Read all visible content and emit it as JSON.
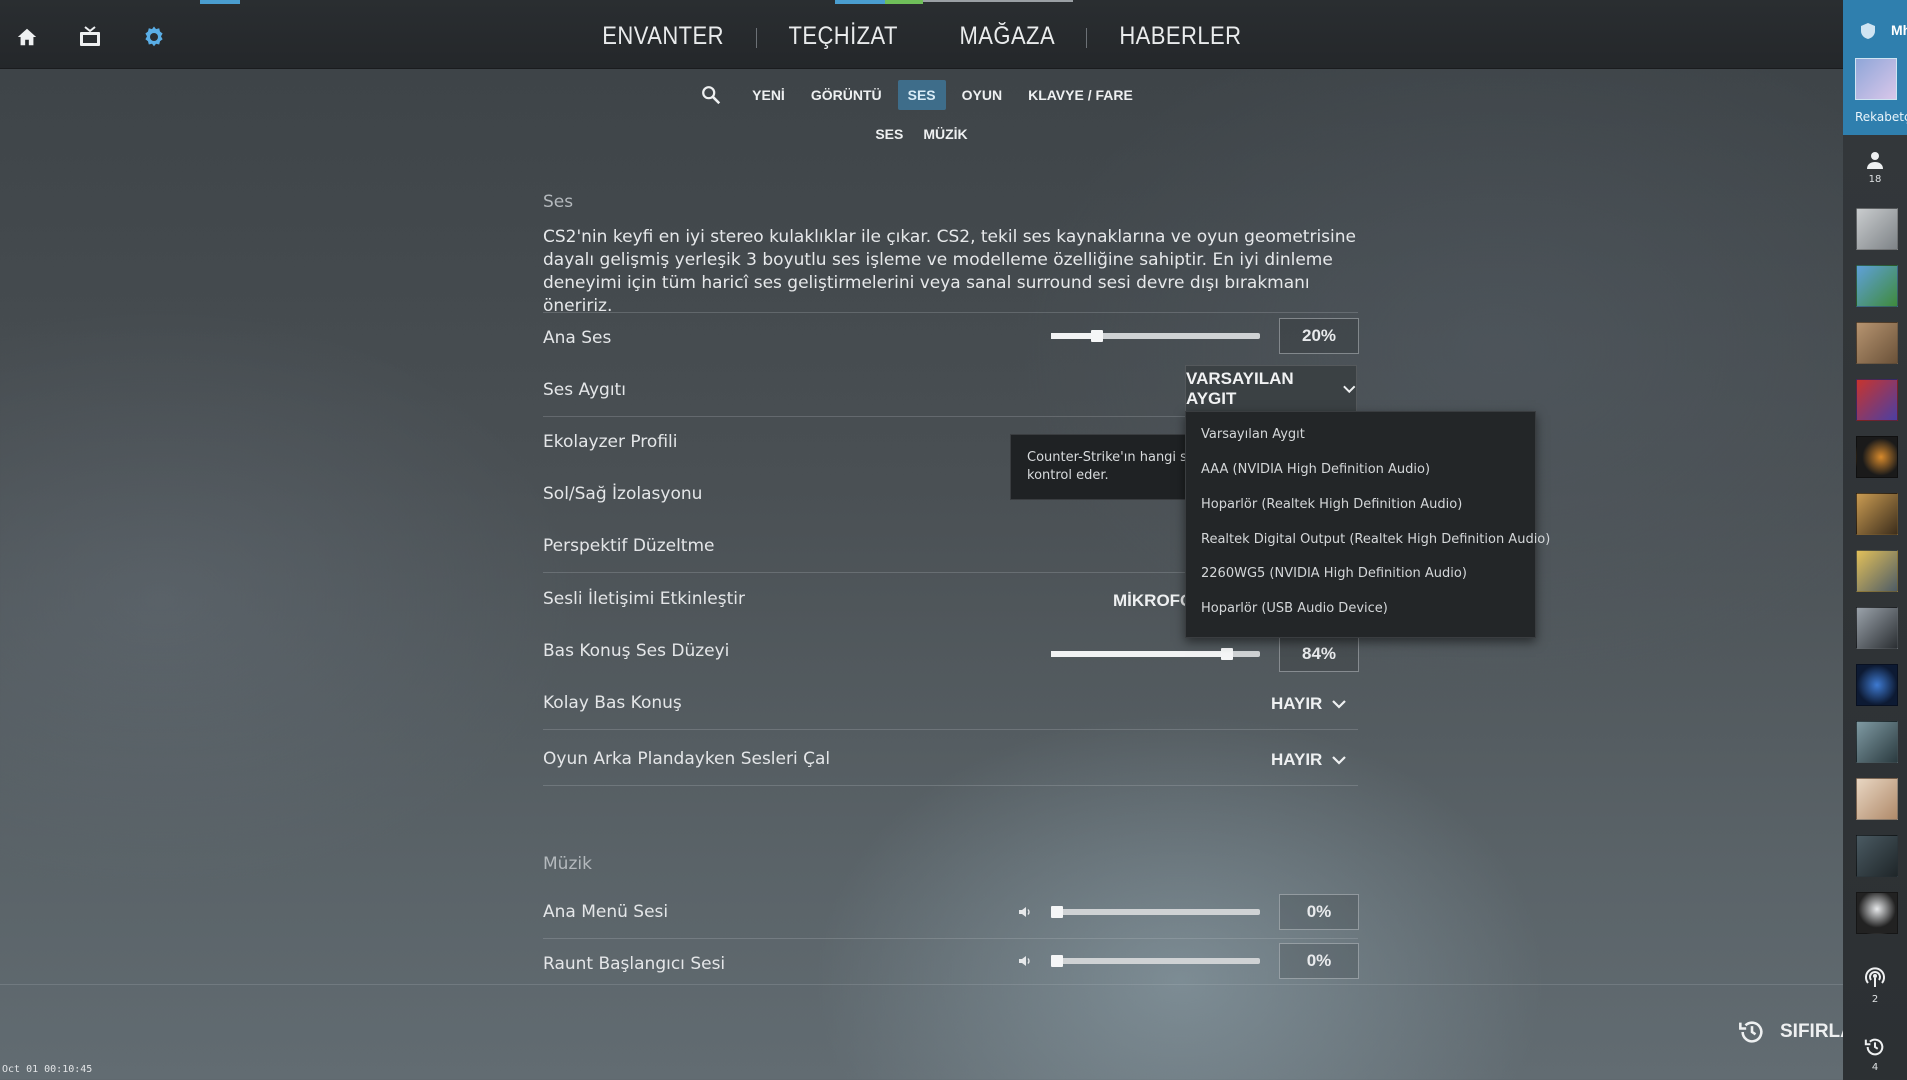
{
  "topbar": {
    "nav": [
      "ENVANTER",
      "TEÇHİZAT",
      "MAĞAZA",
      "HABERLER"
    ],
    "icons": [
      "home-icon",
      "tv-icon",
      "gear-icon"
    ]
  },
  "subnav": {
    "tabs": [
      "YENİ",
      "GÖRÜNTÜ",
      "SES",
      "OYUN",
      "KLAVYE / FARE"
    ],
    "active": "SES"
  },
  "subsub": [
    "SES",
    "MÜZİK"
  ],
  "audio": {
    "section_title": "Ses",
    "description": "CS2'nin keyfi en iyi stereo kulaklıklar ile çıkar. CS2, tekil ses kaynaklarına ve oyun geometrisine dayalı gelişmiş yerleşik 3 boyutlu ses işleme ve modelleme özelliğine sahiptir. En iyi dinleme deneyimi için tüm haricî ses geliştirmelerini veya sanal surround sesi devre dışı bırakmanı öneririz.",
    "master_volume": {
      "label": "Ana Ses",
      "value": "20%",
      "level": 0.22
    },
    "device": {
      "label": "Ses Aygıtı",
      "value": "VARSAYILAN AYGIT"
    },
    "eq": {
      "label": "Ekolayzer Profili"
    },
    "lr": {
      "label": "Sol/Sağ İzolasyonu"
    },
    "perspective": {
      "label": "Perspektif Düzeltme"
    },
    "voice": {
      "label": "Sesli İletişimi Etkinleştir",
      "value": "MİKROFON I"
    },
    "ptt_volume": {
      "label": "Bas Konuş Ses Düzeyi",
      "value": "84%",
      "level": 0.84
    },
    "easy_ptt": {
      "label": "Kolay Bas Konuş",
      "value": "HAYIR"
    },
    "background": {
      "label": "Oyun Arka Plandayken Sesleri Çal",
      "value": "HAYIR"
    }
  },
  "tooltip": {
    "line1": "Counter-Strike'ın hangi ses",
    "line2": "kontrol eder."
  },
  "device_options": [
    "Varsayılan Aygıt",
    "AAA (NVIDIA High Definition Audio)",
    "Hoparlör (Realtek High Definition Audio)",
    "Realtek Digital Output (Realtek High Definition Audio)",
    "2260WG5 (NVIDIA High Definition Audio)",
    "Hoparlör (USB Audio Device)"
  ],
  "music": {
    "section_title": "Müzik",
    "main_menu": {
      "label": "Ana Menü Sesi",
      "value": "0%",
      "level": 0.0
    },
    "round_start": {
      "label": "Raunt Başlangıcı Sesi",
      "value": "0%",
      "level": 0.0
    }
  },
  "footer": {
    "reset_label": "SIFIRLA",
    "clock": "Oct 01 00:10:45"
  },
  "sidebar": {
    "username": "Mht",
    "rank": "Rekabetçi",
    "people_count": "18",
    "broadcast_count": "2",
    "history_count": "4"
  },
  "colors": {
    "active_tab": "#3e6d8a",
    "profile_bg": "#2f7fae",
    "accent_blue": "#4a9ed0",
    "accent_green": "#6fbf5a"
  }
}
